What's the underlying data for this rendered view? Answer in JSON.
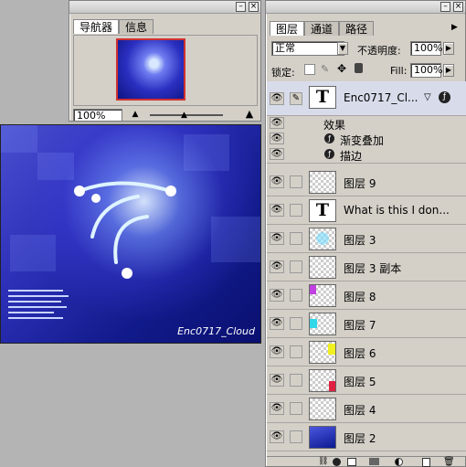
{
  "navigator": {
    "tabs": [
      "导航器",
      "信息"
    ],
    "zoom": "100%"
  },
  "canvas": {
    "watermark": "Enc0717_Cloud"
  },
  "layers_panel": {
    "tabs": [
      "图层",
      "通道",
      "路径"
    ],
    "blend_mode": "正常",
    "opacity_label": "不透明度:",
    "opacity": "100%",
    "lock_label": "锁定:",
    "fill_label": "Fill:",
    "fill": "100%",
    "top_layer": "Enc0717_Cl...",
    "effects_label": "效果",
    "effects": [
      "渐变叠加",
      "描边"
    ],
    "layers": [
      {
        "name": "图层 9",
        "thumb": "empty"
      },
      {
        "name": "What is this  I don...",
        "thumb": "text"
      },
      {
        "name": "图层 3",
        "thumb": "cyan-blur"
      },
      {
        "name": "图层 3 副本",
        "thumb": "empty"
      },
      {
        "name": "图层 8",
        "thumb": "magenta-corner"
      },
      {
        "name": "图层 7",
        "thumb": "cyan-left"
      },
      {
        "name": "图层 6",
        "thumb": "yellow-right"
      },
      {
        "name": "图层 5",
        "thumb": "red-bottom-right"
      },
      {
        "name": "图层 4",
        "thumb": "empty"
      },
      {
        "name": "图层 2",
        "thumb": "blue-fill"
      }
    ],
    "colors": {
      "accent": "#0b3fa8",
      "selected_row": "#d8dcea"
    }
  }
}
